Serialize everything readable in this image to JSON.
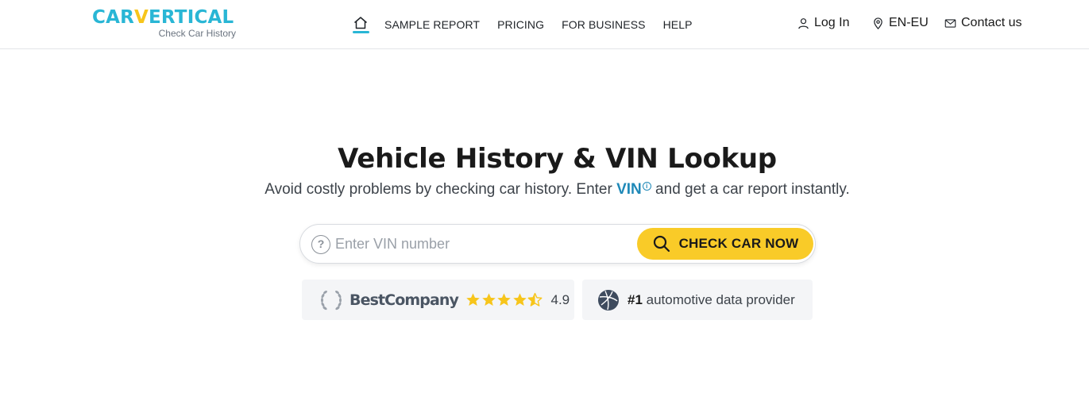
{
  "brand": {
    "logo_part1": "CAR",
    "logo_v": "V",
    "logo_part2": "ERTICAL",
    "tagline": "Check Car History",
    "primary_color": "#29b6d5",
    "accent_color": "#f7c51b"
  },
  "nav": {
    "home_icon": "home-icon",
    "items": [
      "SAMPLE REPORT",
      "PRICING",
      "FOR BUSINESS",
      "HELP"
    ]
  },
  "utils": {
    "login": "Log In",
    "language": "EN-EU",
    "contact": "Contact us"
  },
  "hero": {
    "title": "Vehicle History & VIN Lookup",
    "subtitle_before": "Avoid costly problems by checking car history. Enter ",
    "vin_link": "VIN",
    "vin_info": "i",
    "subtitle_after": " and get a car report instantly."
  },
  "search": {
    "help": "?",
    "placeholder": "Enter VIN number",
    "value": "",
    "button_label": "CHECK CAR NOW",
    "button_color": "#f9cb28"
  },
  "badges": {
    "best_company": {
      "name": "BestCompany",
      "rating": "4.9",
      "stars": 4.5
    },
    "data_provider": {
      "rank": "#1",
      "text": " automotive data provider"
    }
  }
}
